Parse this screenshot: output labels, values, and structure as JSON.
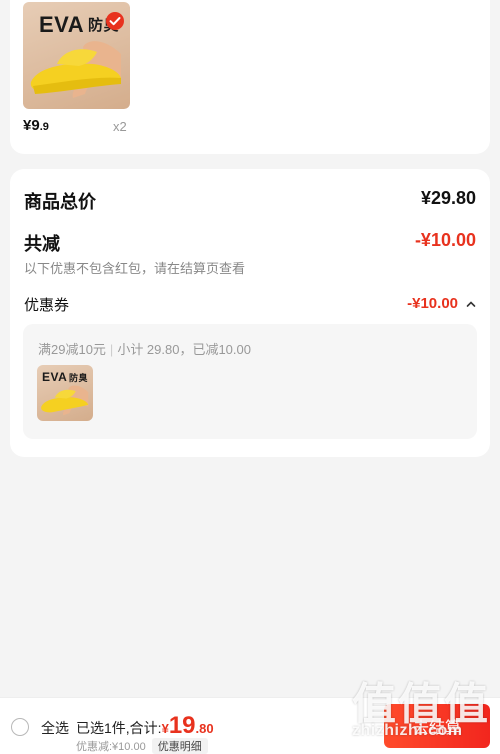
{
  "product": {
    "brand_text": "EVA",
    "brand_sub": "防臭",
    "price_int": "¥9",
    "price_dec": ".9",
    "quantity": "x2"
  },
  "summary": {
    "total_label": "商品总价",
    "total_value": "¥29.80",
    "reduce_label": "共减",
    "reduce_value": "-¥10.00",
    "note": "以下优惠不包含红包，请在结算页查看",
    "coupon_label": "优惠券",
    "coupon_value": "-¥10.00",
    "coupon_rule": "满29减10元",
    "coupon_calc": "小计 29.80，已减10.00"
  },
  "bottom_bar": {
    "select_all": "全选",
    "selected_text": "已选1件,合计:",
    "total_yen": "¥",
    "total_int": "19",
    "total_dec": ".80",
    "discount_text": "优惠减:¥10.00",
    "detail_label": "优惠明细",
    "checkout_label": "去结算"
  },
  "watermark": {
    "glyphs": [
      "值",
      "值",
      "值"
    ],
    "url": "zhizhizhi.com"
  },
  "colors": {
    "accent_red": "#e8321e",
    "page_bg": "#f4f4f4",
    "slipper_yellow": "#f5d021"
  }
}
